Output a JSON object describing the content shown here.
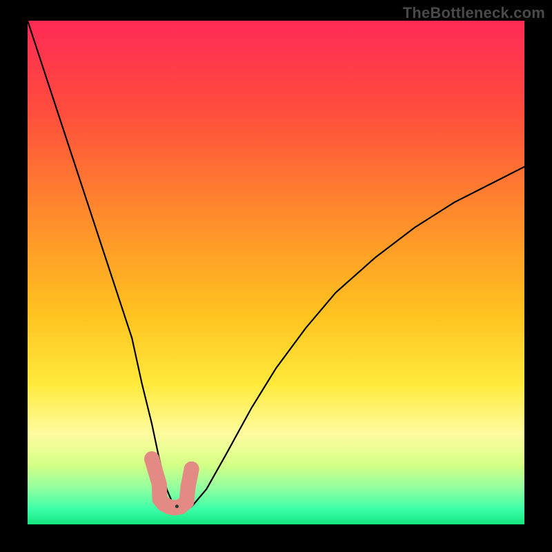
{
  "watermark": "TheBottleneck.com",
  "chart_data": {
    "type": "line",
    "title": "",
    "xlabel": "",
    "ylabel": "",
    "xlim": [
      0,
      100
    ],
    "ylim": [
      0,
      100
    ],
    "grid": false,
    "legend": false,
    "background_gradient": {
      "stops": [
        {
          "offset": 0.0,
          "color": "#ff2a55"
        },
        {
          "offset": 0.18,
          "color": "#ff4d3d"
        },
        {
          "offset": 0.4,
          "color": "#ff8f2b"
        },
        {
          "offset": 0.58,
          "color": "#ffc21f"
        },
        {
          "offset": 0.72,
          "color": "#ffe93a"
        },
        {
          "offset": 0.82,
          "color": "#fffca0"
        },
        {
          "offset": 0.88,
          "color": "#d6ff86"
        },
        {
          "offset": 0.93,
          "color": "#8effa0"
        },
        {
          "offset": 0.97,
          "color": "#3cffa9"
        },
        {
          "offset": 1.0,
          "color": "#15e57e"
        }
      ]
    },
    "series": [
      {
        "name": "bottleneck-curve",
        "color": "#000000",
        "stroke_width": 2.2,
        "x": [
          0,
          3,
          6,
          9,
          12,
          15,
          18,
          21,
          23,
          25,
          26.5,
          28,
          29.5,
          31,
          33,
          36,
          40,
          45,
          50,
          56,
          62,
          70,
          78,
          86,
          94,
          100
        ],
        "values": [
          100,
          91,
          82,
          73,
          64,
          55,
          46,
          37,
          28,
          20,
          13,
          7,
          3.5,
          3,
          3.5,
          7,
          14,
          23,
          31,
          39,
          46,
          53,
          59,
          64,
          68,
          71
        ]
      },
      {
        "name": "highlight-markers",
        "color": "#e48a85",
        "marker": "round",
        "marker_radius": 11,
        "x": [
          25.0,
          26.5,
          26.6,
          27.5,
          28.5,
          29.5,
          30.8,
          32.0,
          32.3,
          33.0
        ],
        "values": [
          13.0,
          8.0,
          5.0,
          4.0,
          3.5,
          3.3,
          3.5,
          4.5,
          7.5,
          11.0
        ]
      }
    ],
    "annotations": []
  }
}
